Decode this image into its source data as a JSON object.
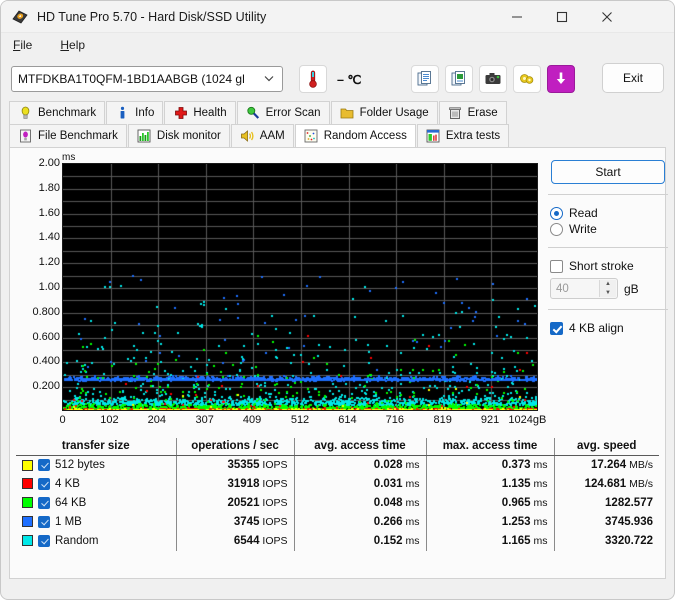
{
  "window": {
    "title": "HD Tune Pro 5.70 - Hard Disk/SSD Utility",
    "app_icon": "hard-disk-icon",
    "minimize_label": "–",
    "maximize_label": "□",
    "close_label": "✕"
  },
  "menu": [
    {
      "label": "File",
      "mnemonic": "F"
    },
    {
      "label": "Help",
      "mnemonic": "H"
    }
  ],
  "toolbar": {
    "drive_value": "MTFDKBA1T0QFM-1BD1AABGB (1024 gl",
    "drive_chevron": "⌄",
    "temperature": "– ℃",
    "thermometer_icon": "thermometer-icon",
    "buttons": [
      {
        "name": "copy-icon"
      },
      {
        "name": "copy-image-icon"
      },
      {
        "name": "screenshot-camera-icon"
      },
      {
        "name": "settings-gear-icon"
      },
      {
        "name": "save-download-icon"
      }
    ],
    "exit_label": "Exit",
    "accent_color": "#c01fc0"
  },
  "tabs": {
    "row1": [
      {
        "label": "Benchmark",
        "icon": "lightbulb-icon",
        "active": false
      },
      {
        "label": "Info",
        "icon": "info-icon",
        "active": false
      },
      {
        "label": "Health",
        "icon": "red-cross-icon",
        "active": false
      },
      {
        "label": "Error Scan",
        "icon": "magnifier-icon",
        "active": false
      },
      {
        "label": "Folder Usage",
        "icon": "folder-icon",
        "active": false
      },
      {
        "label": "Erase",
        "icon": "trash-icon",
        "active": false
      }
    ],
    "row2": [
      {
        "label": "File Benchmark",
        "icon": "file-benchmark-icon",
        "active": false
      },
      {
        "label": "Disk monitor",
        "icon": "bar-chart-icon",
        "active": false
      },
      {
        "label": "AAM",
        "icon": "speaker-icon",
        "active": false
      },
      {
        "label": "Random Access",
        "icon": "scatter-dots-icon",
        "active": true
      },
      {
        "label": "Extra tests",
        "icon": "grid-chart-icon",
        "active": false
      }
    ]
  },
  "controls": {
    "start_label": "Start",
    "mode_label_read": "Read",
    "mode_label_write": "Write",
    "mode_selected": "Read",
    "short_stroke_label": "Short stroke",
    "short_stroke_checked": false,
    "short_stroke_value": "40",
    "short_stroke_unit": "gB",
    "align_label": "4 KB align",
    "align_checked": true,
    "spin_up": "▲",
    "spin_down": "▼"
  },
  "chart_data": {
    "type": "scatter",
    "title": "",
    "xlabel": "",
    "ylabel": "ms",
    "yunit_label": "ms",
    "xunit_label": "gB",
    "xlim": [
      0,
      1024
    ],
    "ylim": [
      0,
      2.0
    ],
    "grid": true,
    "legend_position": "table-below",
    "yticks": [
      "2.00",
      "1.80",
      "1.60",
      "1.40",
      "1.20",
      "1.00",
      "0.800",
      "0.600",
      "0.400",
      "0.200"
    ],
    "ytick_values": [
      2.0,
      1.8,
      1.6,
      1.4,
      1.2,
      1.0,
      0.8,
      0.6,
      0.4,
      0.2
    ],
    "xticks": [
      "0",
      "102",
      "204",
      "307",
      "409",
      "512",
      "614",
      "716",
      "819",
      "921",
      "1024gB"
    ],
    "xtick_values": [
      0,
      102,
      204,
      307,
      409,
      512,
      614,
      716,
      819,
      921,
      1024
    ],
    "background": "#000000",
    "gridline_color": "#5a5a5a",
    "series": [
      {
        "name": "512 bytes",
        "color": "#ffff00",
        "mean_ms": 0.028,
        "max_ms": 0.373,
        "count": 1500
      },
      {
        "name": "4 KB",
        "color": "#ff0000",
        "mean_ms": 0.031,
        "max_ms": 1.135,
        "count": 1500
      },
      {
        "name": "64 KB",
        "color": "#00ff00",
        "mean_ms": 0.048,
        "max_ms": 0.965,
        "count": 1500
      },
      {
        "name": "1 MB",
        "color": "#1e6fff",
        "mean_ms": 0.266,
        "max_ms": 1.253,
        "count": 900
      },
      {
        "name": "Random",
        "color": "#00e8e8",
        "mean_ms": 0.152,
        "max_ms": 1.165,
        "count": 1400
      }
    ]
  },
  "results": {
    "headers": [
      "transfer size",
      "operations / sec",
      "avg. access time",
      "max. access time",
      "avg. speed"
    ],
    "rows": [
      {
        "color": "#ffff00",
        "checked": true,
        "label": "512 bytes",
        "ops": "35355",
        "ops_unit": "IOPS",
        "avg_access": "0.028",
        "avg_access_unit": "ms",
        "max_access": "0.373",
        "max_access_unit": "ms",
        "avg_speed": "17.264",
        "avg_speed_unit": "MB/s"
      },
      {
        "color": "#ff0000",
        "checked": true,
        "label": "4 KB",
        "ops": "31918",
        "ops_unit": "IOPS",
        "avg_access": "0.031",
        "avg_access_unit": "ms",
        "max_access": "1.135",
        "max_access_unit": "ms",
        "avg_speed": "124.681",
        "avg_speed_unit": "MB/s"
      },
      {
        "color": "#00ff00",
        "checked": true,
        "label": "64 KB",
        "ops": "20521",
        "ops_unit": "IOPS",
        "avg_access": "0.048",
        "avg_access_unit": "ms",
        "max_access": "0.965",
        "max_access_unit": "ms",
        "avg_speed": "1282.577",
        "avg_speed_unit": ""
      },
      {
        "color": "#1e6fff",
        "checked": true,
        "label": "1 MB",
        "ops": "3745",
        "ops_unit": "IOPS",
        "avg_access": "0.266",
        "avg_access_unit": "ms",
        "max_access": "1.253",
        "max_access_unit": "ms",
        "avg_speed": "3745.936",
        "avg_speed_unit": ""
      },
      {
        "color": "#00e8e8",
        "checked": true,
        "label": "Random",
        "ops": "6544",
        "ops_unit": "IOPS",
        "avg_access": "0.152",
        "avg_access_unit": "ms",
        "max_access": "1.165",
        "max_access_unit": "ms",
        "avg_speed": "3320.722",
        "avg_speed_unit": ""
      }
    ]
  }
}
